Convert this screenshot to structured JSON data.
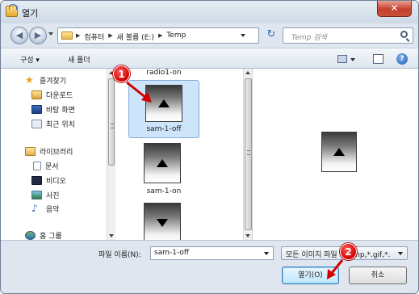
{
  "window": {
    "title": "열기",
    "close_symbol": "✕"
  },
  "nav": {
    "back_symbol": "◀",
    "forward_symbol": "▶",
    "breadcrumb": [
      "컴퓨터",
      "새 볼륨 (E:)",
      "Temp"
    ],
    "refresh_symbol": "↻",
    "search_placeholder": "Temp 검색"
  },
  "toolbar": {
    "organize_label": "구성 ▾",
    "new_folder_label": "새 폴더",
    "help_symbol": "?"
  },
  "sidebar": {
    "favorites": [
      {
        "label": "즐겨찾기",
        "icon": "star-icon"
      },
      {
        "label": "다운로드",
        "icon": "downloads-folder-icon"
      },
      {
        "label": "바탕 화면",
        "icon": "desktop-icon"
      },
      {
        "label": "최근 위치",
        "icon": "recent-places-icon"
      }
    ],
    "libraries": [
      {
        "label": "라이브러리",
        "icon": "library-icon"
      },
      {
        "label": "문서",
        "icon": "documents-icon"
      },
      {
        "label": "비디오",
        "icon": "video-icon"
      },
      {
        "label": "사진",
        "icon": "pictures-icon"
      },
      {
        "label": "음악",
        "icon": "music-icon"
      }
    ],
    "homegroup": {
      "label": "홈 그룹",
      "icon": "homegroup-icon"
    }
  },
  "files": [
    {
      "name": "radio1-on",
      "selected": false
    },
    {
      "name": "sam-1-off",
      "selected": true,
      "arrow": "up"
    },
    {
      "name": "sam-1-on",
      "selected": false,
      "arrow": "up"
    },
    {
      "name": "",
      "selected": false,
      "arrow": "down"
    }
  ],
  "preview": {
    "arrow": "up"
  },
  "footer": {
    "filename_label": "파일 이름(N):",
    "filename_value": "sam-1-off",
    "filetype_value": "모든 이미지 파일 (*.bmp,*.gif,*.",
    "open_label": "열기(O)",
    "cancel_label": "취소"
  },
  "callouts": [
    {
      "number": "1"
    },
    {
      "number": "2"
    }
  ],
  "colors": {
    "callout": "#d40000",
    "selection": "#cde4fb",
    "accent": "#3c7fb1"
  }
}
